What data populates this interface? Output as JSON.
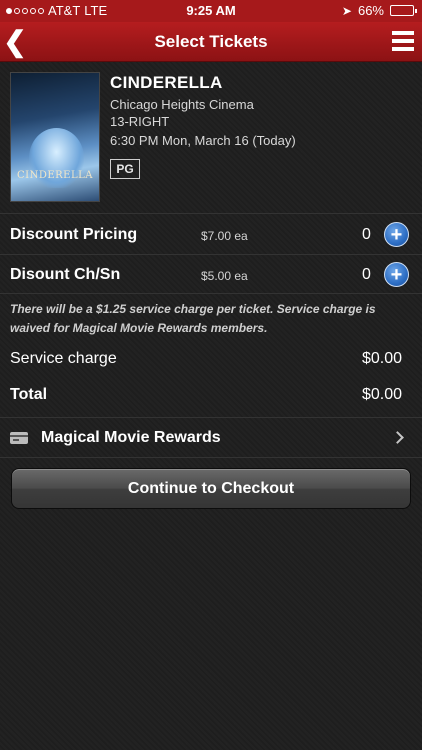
{
  "status_bar": {
    "carrier": "AT&T",
    "network": "LTE",
    "time": "9:25 AM",
    "battery": "66%",
    "battery_level": 0.66
  },
  "nav": {
    "back_icon": "chevron-left-icon",
    "title": "Select Tickets",
    "menu_icon": "hamburger-menu-icon"
  },
  "movie": {
    "poster_title": "CINDERELLA",
    "title": "CINDERELLA",
    "theater": "Chicago Heights Cinema",
    "auditorium": "13-RIGHT",
    "showtime": "6:30 PM Mon, March 16 (Today)",
    "rating": "PG"
  },
  "tickets": [
    {
      "label": "Discount Pricing",
      "price": "$7.00 ea",
      "qty": "0"
    },
    {
      "label": "Disount Ch/Sn",
      "price": "$5.00 ea",
      "qty": "0"
    }
  ],
  "summary": {
    "notice": "There will be a $1.25 service charge per ticket. Service charge is waived for Magical Movie Rewards members.",
    "service_charge_label": "Service charge",
    "service_charge_value": "$0.00",
    "total_label": "Total",
    "total_value": "$0.00"
  },
  "rewards": {
    "label": "Magical Movie Rewards"
  },
  "checkout": {
    "label": "Continue to Checkout"
  },
  "colors": {
    "nav_red": "#a6191b",
    "plus_blue": "#2d6ec4"
  }
}
